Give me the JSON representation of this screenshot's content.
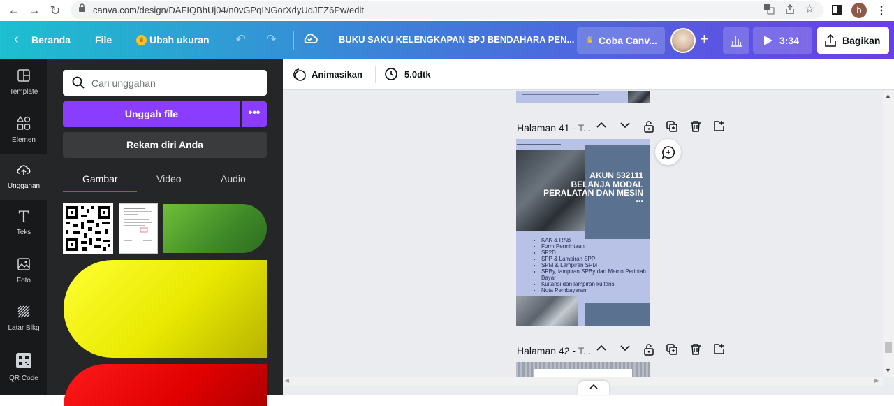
{
  "browser": {
    "url": "canva.com/design/DAFIQBhUj04/n0vGPqINGorXdyUdJEZ6Pw/edit",
    "profile_initial": "b"
  },
  "toolbar": {
    "home_label": "Beranda",
    "file_label": "File",
    "resize_label": "Ubah ukuran",
    "doc_title": "BUKU SAKU KELENGKAPAN SPJ BENDAHARA PEN...",
    "trial_label": "Coba Canv...",
    "present_duration": "3:34",
    "share_label": "Bagikan"
  },
  "rail": {
    "items": [
      {
        "label": "Template",
        "icon": "template-icon"
      },
      {
        "label": "Elemen",
        "icon": "elements-icon"
      },
      {
        "label": "Unggahan",
        "icon": "upload-icon"
      },
      {
        "label": "Teks",
        "icon": "text-icon"
      },
      {
        "label": "Foto",
        "icon": "photo-icon"
      },
      {
        "label": "Latar Blkg",
        "icon": "background-icon"
      },
      {
        "label": "QR Code",
        "icon": "qr-code-icon"
      }
    ]
  },
  "panel": {
    "search_placeholder": "Cari unggahan",
    "upload_label": "Unggah file",
    "more_label": "•••",
    "record_label": "Rekam diri Anda",
    "tabs": [
      "Gambar",
      "Video",
      "Audio"
    ]
  },
  "context": {
    "animate_label": "Animasikan",
    "duration_label": "5.0dtk"
  },
  "pages": {
    "p41_label": "Halaman 41 - ",
    "p41_title_hint": "T...",
    "p42_label": "Halaman 42 - ",
    "p42_title_hint": "T..."
  },
  "design41": {
    "title_lines": [
      "AKUN 532111",
      "BELANJA MODAL",
      "PERALATAN DAN MESIN"
    ],
    "dots": "•••",
    "list": [
      "KAK & RAB",
      "Form Permintaan",
      "SP2D",
      "SPP & Lampiran SPP",
      "SPM & Lampiran SPM",
      "SPBy, lampiran SPBy dan Memo Perintah Bayar",
      "Kuitansi dan lampiran kuitansi",
      "Nota Pembayaran"
    ]
  },
  "colors": {
    "accent_purple": "#8b3dff",
    "rail_bg": "#18191b",
    "panel_bg": "#252627",
    "workspace_bg": "#ebecf0"
  }
}
